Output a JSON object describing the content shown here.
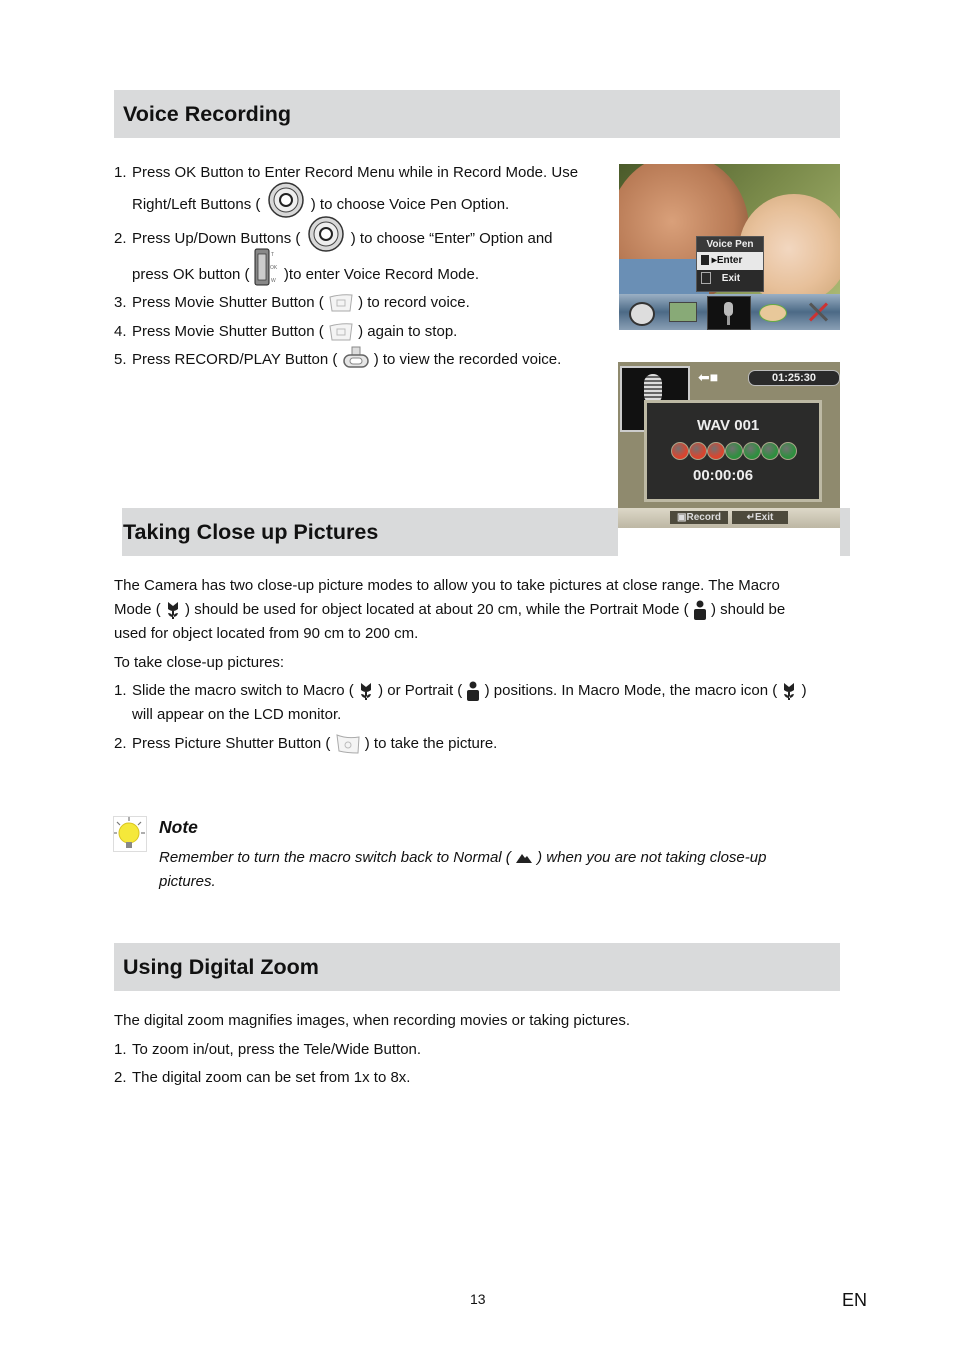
{
  "sections": {
    "voice": {
      "title": "Voice Recording",
      "steps": [
        {
          "n": "1.",
          "a": "Press OK Button to Enter Record Menu while in Record Mode. Use",
          "b1": "Right/Left Buttons (",
          "b2": ") to choose Voice Pen Option."
        },
        {
          "n": "2.",
          "a1": "Press Up/Down Buttons (",
          "a2": ") to choose “Enter” Option and",
          "b1": "press OK button (",
          "b2": ")to enter Voice Record Mode."
        },
        {
          "n": "3.",
          "a1": "Press Movie Shutter Button (",
          "a2": ") to record voice."
        },
        {
          "n": "4.",
          "a1": "Press Movie Shutter Button (",
          "a2": ") again to stop."
        },
        {
          "n": "5.",
          "a1": "Press RECORD/PLAY Button (",
          "a2": ") to view the recorded voice."
        }
      ],
      "screen1": {
        "menu_title": "Voice Pen",
        "menu_items": [
          "Enter",
          "Exit"
        ],
        "icons": [
          "movie-mode-icon",
          "camera-mode-icon",
          "voice-pen-icon",
          "effect-palette-icon",
          "settings-tools-icon"
        ]
      },
      "screen2": {
        "clock": "01:25:30",
        "file": "WAV 001",
        "elapsed": "00:00:06",
        "level_leds": {
          "red": 3,
          "green": 4
        },
        "buttons": [
          "Record",
          "Exit"
        ]
      }
    },
    "closeup": {
      "title": "Taking Close up Pictures",
      "intro_l1": "The Camera has two close-up picture modes to allow you to take pictures at close range. The Macro",
      "intro_l2a": "Mode (",
      "intro_l2b": ") should be used for object located at about 20 cm, while the Portrait Mode (",
      "intro_l2c": ") should be",
      "intro_l3": "used for object located from 90 cm to 200 cm.",
      "lead": "To take close-up pictures:",
      "step1_n": "1.",
      "step1_a": "Slide the macro switch to Macro (",
      "step1_b": ") or Portrait (",
      "step1_c": ") positions. In Macro Mode, the macro icon (",
      "step1_d": ")",
      "step1_l2": "will appear on the LCD monitor.",
      "step2_n": "2.",
      "step2_a": "Press Picture Shutter Button (",
      "step2_b": ") to take the picture."
    },
    "note": {
      "title": "Note",
      "text_a": "Remember to turn the macro switch back to Normal (",
      "text_b": ") when you are not taking close-up",
      "text_l2": "pictures."
    },
    "zoom": {
      "title": "Using Digital Zoom",
      "intro": "The digital zoom magnifies images, when recording movies or taking pictures.",
      "steps": [
        {
          "n": "1.",
          "t": "To zoom in/out, press the Tele/Wide Button."
        },
        {
          "n": "2.",
          "t": "The digital zoom can be set from 1x to 8x."
        }
      ]
    }
  },
  "footer": {
    "page": "13",
    "lang": "EN"
  }
}
